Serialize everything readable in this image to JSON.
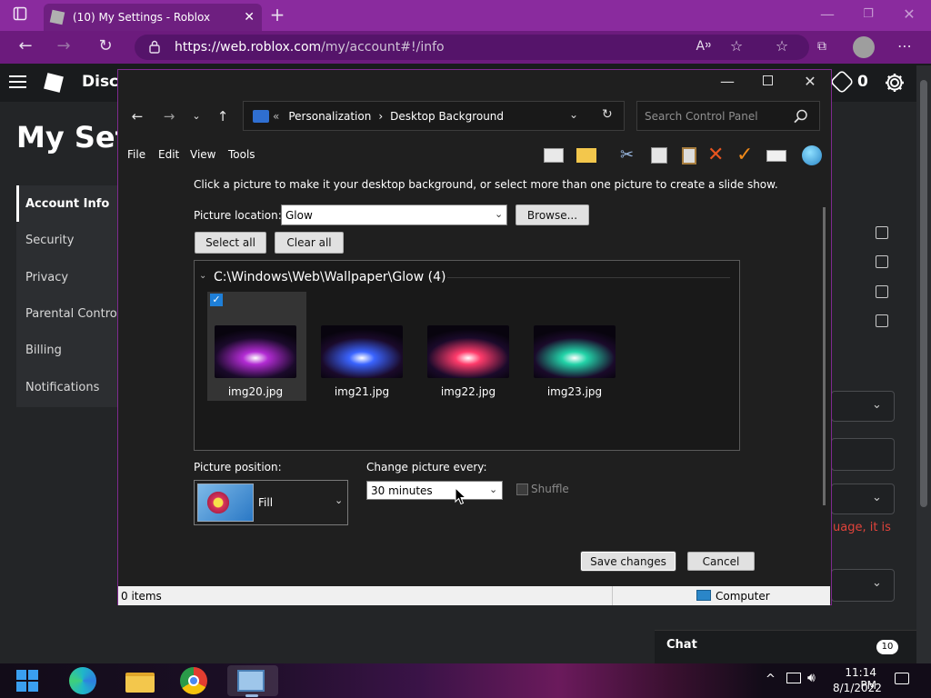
{
  "browser": {
    "tab_title": "(10) My Settings - Roblox",
    "url_host": "https://web.roblox.com",
    "url_path": "/my/account#!/info"
  },
  "roblox": {
    "nav_label": "Disco",
    "page_title": "My Set",
    "robux": "0",
    "sidebar": [
      {
        "label": "Account Info"
      },
      {
        "label": "Security"
      },
      {
        "label": "Privacy"
      },
      {
        "label": "Parental Contro"
      },
      {
        "label": "Billing"
      },
      {
        "label": "Notifications"
      }
    ],
    "warning_fragment": "uage, it is",
    "chat_label": "Chat",
    "chat_count": "10"
  },
  "dialog": {
    "breadcrumb_prefix": "«",
    "breadcrumb_1": "Personalization",
    "breadcrumb_sep": "›",
    "breadcrumb_2": "Desktop Background",
    "search_placeholder": "Search Control Panel",
    "menu": [
      "File",
      "Edit",
      "View",
      "Tools"
    ],
    "instructions": "Click a picture to make it your desktop background, or select more than one picture to create a slide show.",
    "picture_location_label": "Picture location:",
    "picture_location_value": "Glow",
    "browse_label": "Browse...",
    "select_all_label": "Select all",
    "clear_all_label": "Clear all",
    "group_title": "C:\\Windows\\Web\\Wallpaper\\Glow (4)",
    "images": [
      {
        "name": "img20.jpg",
        "selected": true,
        "color": "#b22bd3"
      },
      {
        "name": "img21.jpg",
        "selected": false,
        "color": "#3a64ff"
      },
      {
        "name": "img22.jpg",
        "selected": false,
        "color": "#ff3b6b"
      },
      {
        "name": "img23.jpg",
        "selected": false,
        "color": "#22d3a8"
      }
    ],
    "picture_position_label": "Picture position:",
    "picture_position_value": "Fill",
    "change_every_label": "Change picture every:",
    "change_every_value": "30 minutes",
    "shuffle_label": "Shuffle",
    "save_label": "Save changes",
    "cancel_label": "Cancel",
    "status_items": "0 items",
    "status_zone": "Computer"
  },
  "taskbar": {
    "time": "11:14 PM",
    "date": "8/1/2022"
  },
  "colors": {
    "browser_accent": "#8a2b9e",
    "warning": "#e0433b",
    "selection": "#1e7fd8"
  }
}
